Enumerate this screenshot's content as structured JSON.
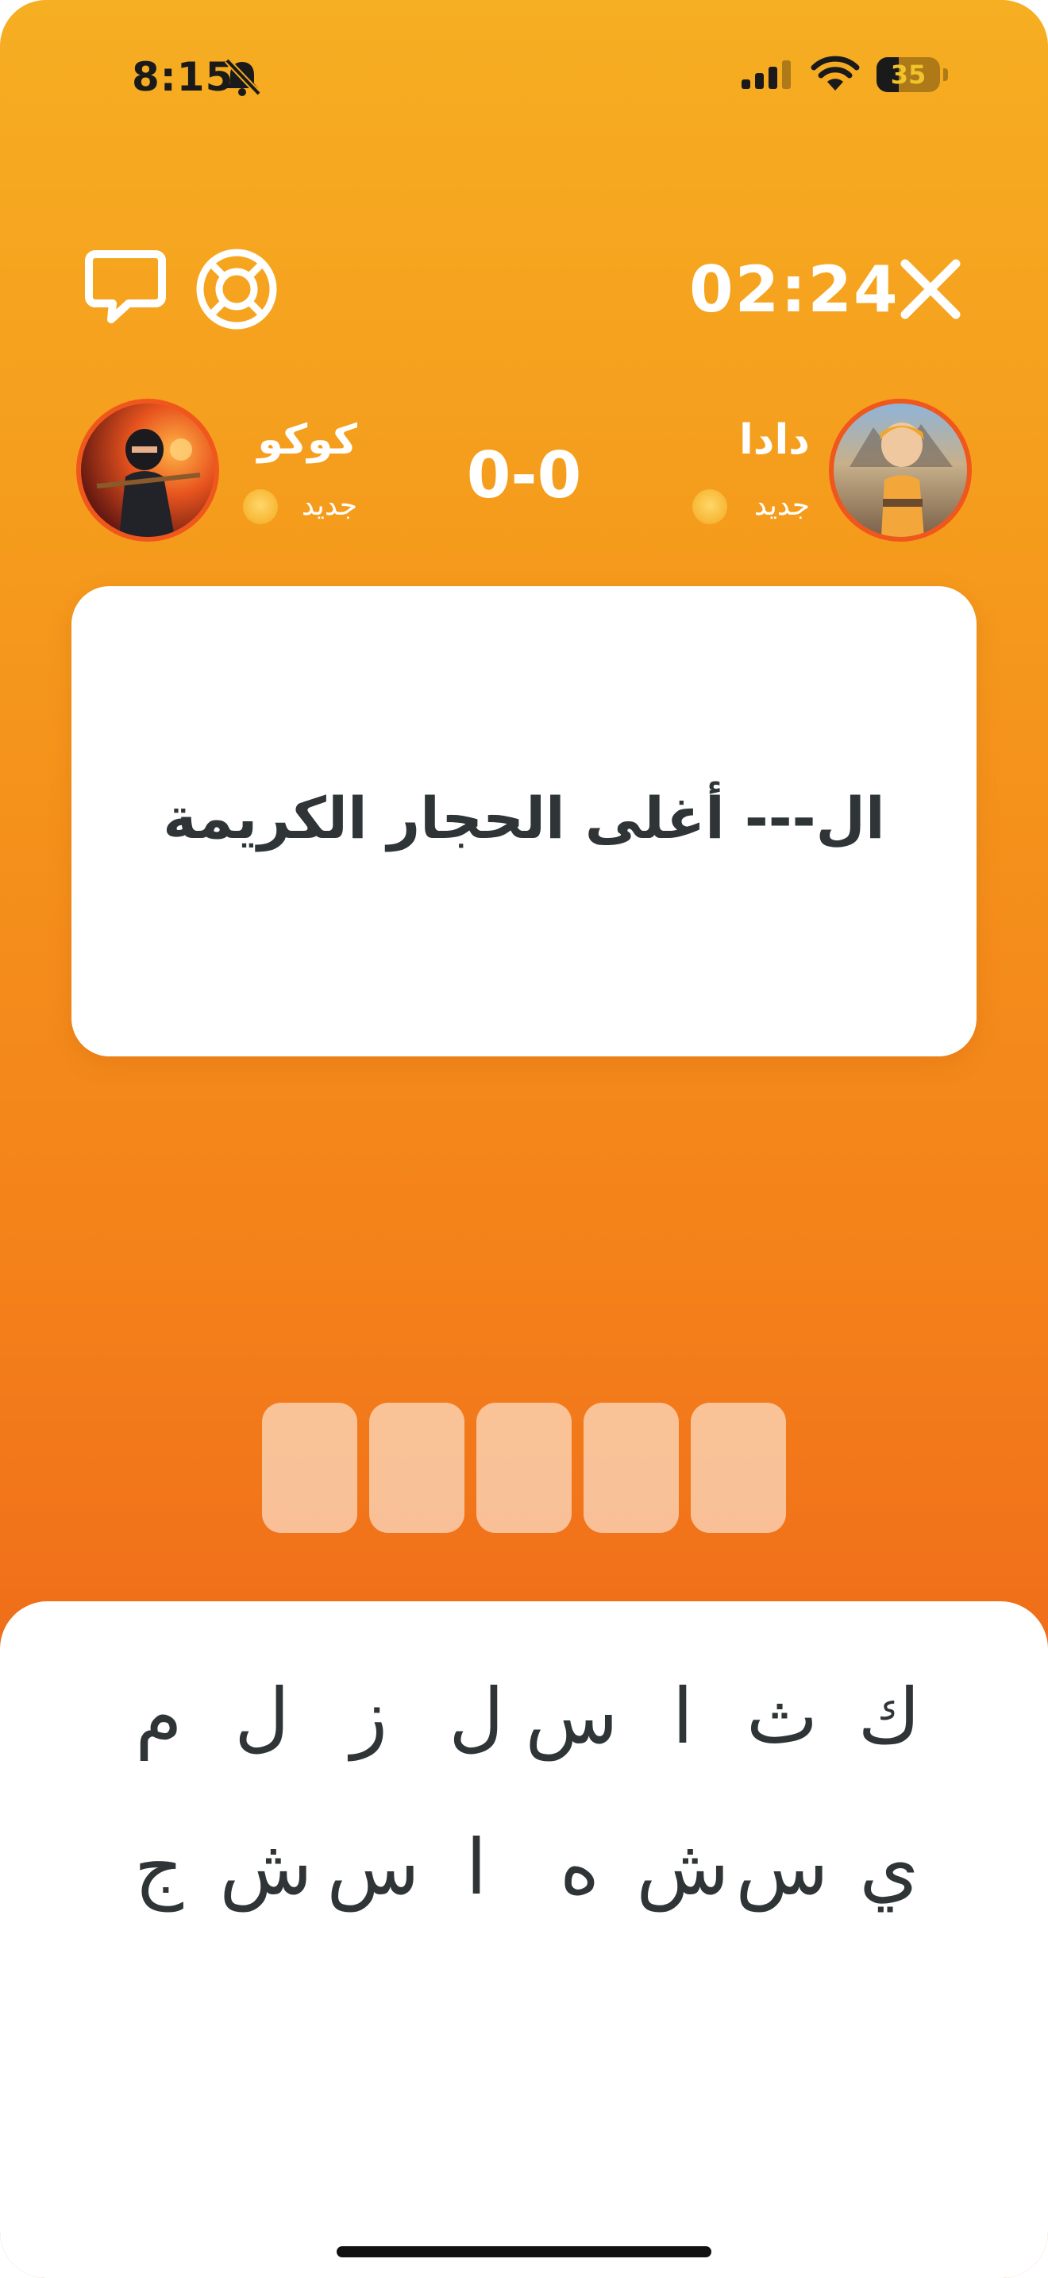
{
  "status_bar": {
    "time": "8:15",
    "battery": "35"
  },
  "header": {
    "timer": "02:24"
  },
  "players": {
    "right": {
      "name": "دادا",
      "level": "جديد"
    },
    "left": {
      "name": "كوكو",
      "level": "جديد"
    },
    "score": "0-0"
  },
  "question": {
    "text": "ال--- أغلى الحجار الكريمة"
  },
  "answer": {
    "slots": 5
  },
  "keyboard": {
    "row1": [
      "ك",
      "ث",
      "ا",
      "س",
      "ل",
      "ز",
      "ل",
      "م"
    ],
    "row2": [
      "ي",
      "س",
      "ش",
      "ه",
      "ا",
      "س",
      "ش",
      "ج"
    ]
  },
  "icons": {
    "chat": "chat-bubble-icon",
    "help": "lifebuoy-icon",
    "close": "close-icon",
    "mute": "bell-slash-icon",
    "signal": "cellular-signal-icon",
    "wifi": "wifi-icon"
  },
  "colors": {
    "gradient_top": "#f6ae22",
    "gradient_bottom": "#eb5c18",
    "avatar_ring": "#f0571c",
    "text_dark": "#2f3437"
  }
}
